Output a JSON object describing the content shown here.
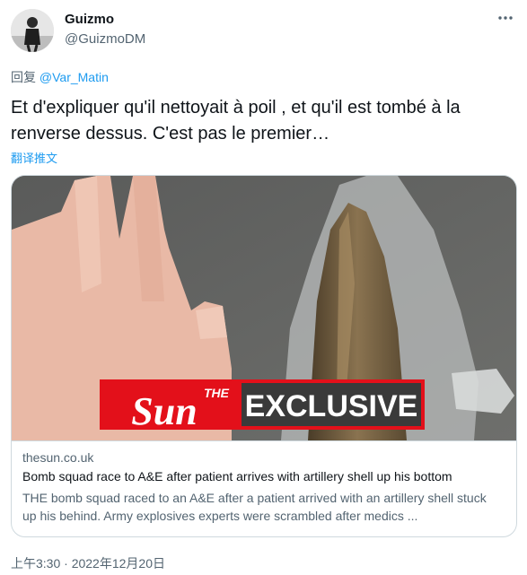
{
  "author": {
    "name": "Guizmo",
    "handle": "@GuizmoDM"
  },
  "reply": {
    "prefix": "回复",
    "mention": "@Var_Matin"
  },
  "tweet": {
    "text": "Et d'expliquer qu'il nettoyait à poil , et qu'il est tombé à la renverse dessus. C'est pas le premier…",
    "translate_label": "翻译推文",
    "more_icon": "more-horizontal-icon"
  },
  "card": {
    "image": {
      "logo_small": "THE",
      "logo_main": "Sun",
      "banner": "EXCLUSIVE",
      "colors": {
        "brand_red": "#e3101a",
        "banner_dark": "#3a3a3a"
      }
    },
    "domain": "thesun.co.uk",
    "title": "Bomb squad race to A&E after patient arrives with artillery shell up his bottom",
    "description": "THE bomb squad raced to an A&E after a patient arrived with an artillery shell stuck up his behind. Army explosives experts were scrambled after medics ..."
  },
  "timestamp": "上午3:30 · 2022年12月20日",
  "colors": {
    "link": "#1d9bf0",
    "secondary": "#536471",
    "text": "#0f1419",
    "border": "#cfd9de"
  }
}
